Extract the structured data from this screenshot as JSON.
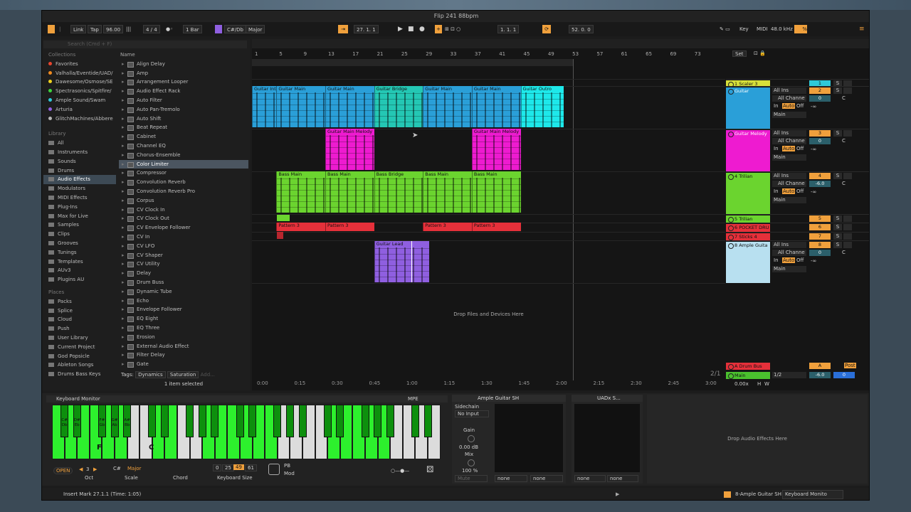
{
  "title": "Flip 241 88bpm",
  "colors": {
    "accent": "#f0a03c",
    "selection": "#4b5560",
    "lime": "#2df02d"
  },
  "transport": {
    "link": "Link",
    "tap": "Tap",
    "tempo": "96.00",
    "sig": "4 / 4",
    "quant": "1 Bar",
    "key": "C#/Db",
    "scale": "Major",
    "pos": "27. 1. 1",
    "loop_start": "1. 1. 1",
    "loop_len": "52. 0. 0",
    "key_btn": "Key",
    "midi_btn": "MIDI",
    "sample_rate": "48.0 kHz",
    "cpu": "%"
  },
  "browser": {
    "search_placeholder": "Search (Cmd + F)",
    "name_header": "Name",
    "collections_header": "Collections",
    "collections": [
      {
        "label": "Favorites",
        "color": "#e8452e"
      },
      {
        "label": "Valhalla/Eventide/UAD/",
        "color": "#f08a1f"
      },
      {
        "label": "Dawesome/Osmose/SE",
        "color": "#f0d21f"
      },
      {
        "label": "Spectrasonics/Spitfire/",
        "color": "#3dd43d"
      },
      {
        "label": "Ample Sound/Swam",
        "color": "#2fc9d8"
      },
      {
        "label": "Arturia",
        "color": "#8f5fe0"
      },
      {
        "label": "GlitchMachines/Abbere",
        "color": "#b5b5b5"
      }
    ],
    "library_header": "Library",
    "library": [
      "All",
      "Instruments",
      "Sounds",
      "Drums",
      "Audio Effects",
      "Modulators",
      "MIDI Effects",
      "Plug-Ins",
      "Max for Live",
      "Samples",
      "Clips",
      "Grooves",
      "Tunings",
      "Templates",
      "AUv3",
      "Plugins AU"
    ],
    "places_header": "Places",
    "places": [
      "Packs",
      "Splice",
      "Cloud",
      "Push",
      "User Library",
      "Current Project",
      "God Popsicle",
      "Ableton Songs",
      "Drums Bass Keys"
    ],
    "items": [
      "Align Delay",
      "Amp",
      "Arrangement Looper",
      "Audio Effect Rack",
      "Auto Filter",
      "Auto Pan-Tremolo",
      "Auto Shift",
      "Beat Repeat",
      "Cabinet",
      "Channel EQ",
      "Chorus-Ensemble",
      "Color Limiter",
      "Compressor",
      "Convolution Reverb",
      "Convolution Reverb Pro",
      "Corpus",
      "CV Clock In",
      "CV Clock Out",
      "CV Envelope Follower",
      "CV In",
      "CV LFO",
      "CV Shaper",
      "CV Utility",
      "Delay",
      "Drum Buss",
      "Dynamic Tube",
      "Echo",
      "Envelope Follower",
      "EQ Eight",
      "EQ Three",
      "Erosion",
      "External Audio Effect",
      "Filter Delay",
      "Gate"
    ],
    "tags_label": "Tags:",
    "tags": [
      "Dynamics",
      "Saturation",
      "Add..."
    ],
    "status": "1 item selected"
  },
  "ruler": [
    "1",
    "5",
    "9",
    "13",
    "17",
    "21",
    "25",
    "29",
    "33",
    "37",
    "41",
    "45",
    "49",
    "53",
    "57",
    "61",
    "65",
    "69",
    "73"
  ],
  "timeline": [
    "0:00",
    "0:15",
    "0:30",
    "0:45",
    "1:00",
    "1:15",
    "1:30",
    "1:45",
    "2:00",
    "2:15",
    "2:30",
    "2:45",
    "3:00"
  ],
  "clips": {
    "gi": "Guitar Intro",
    "gm": "Guitar Main",
    "gb": "Guitar Bridge",
    "go": "Guitar Outro",
    "gmm": "Guitar Main Melody",
    "bm": "Bass Main",
    "bb": "Bass Bridge",
    "p3": "Pattern 3",
    "gl": "Guitar Lead"
  },
  "drop_files": "Drop Files and Devices Here",
  "tracks": [
    {
      "name": "1 Scaler 3",
      "num": "1"
    },
    {
      "name": "Guitar",
      "num": "2",
      "in": "All Ins",
      "ch": "All Channe",
      "mon": "In",
      "auto": "Auto",
      "off": "Off",
      "vol": "0",
      "pan": "C",
      "out": "Main",
      "db": "-∞"
    },
    {
      "name": "Guitar Melody",
      "num": "3",
      "in": "All Ins",
      "ch": "All Channe",
      "mon": "In",
      "auto": "Auto",
      "off": "Off",
      "vol": "0",
      "pan": "C",
      "out": "Main",
      "db": "-∞"
    },
    {
      "name": "4 Trilian",
      "num": "4",
      "in": "All Ins",
      "ch": "All Channe",
      "mon": "In",
      "auto": "Auto",
      "off": "Off",
      "vol": "-6.0",
      "pan": "C",
      "out": "Main",
      "db": "-∞"
    },
    {
      "name": "5 Trilian",
      "num": "5"
    },
    {
      "name": "6 POCKET DRU",
      "num": "6"
    },
    {
      "name": "7 Sticks 4",
      "num": "7"
    },
    {
      "name": "8 Ample Guita",
      "num": "8",
      "in": "All Ins",
      "ch": "All Channe",
      "mon": "In",
      "auto": "Auto",
      "off": "Off",
      "vol": "0",
      "pan": "C",
      "out": "Main",
      "db": "-∞"
    }
  ],
  "returns": {
    "drum_bus": "A Drum Bus",
    "ret": "A",
    "post": "Post",
    "main": "Main",
    "main_out": "1/2",
    "main_vol": "-6.0",
    "main_pan": "0",
    "sets": "Set",
    "page": "2/1",
    "zoom": "0.00x",
    "h": "H",
    "w": "W",
    "s": "S"
  },
  "devices": {
    "kbd_title": "Keyboard Monitor",
    "mpe": "MPE",
    "open": "OPEN",
    "oct_val": "3",
    "oct": "Oct",
    "root": "C#",
    "mode": "Major",
    "scale": "Scale",
    "chord": "Chord",
    "ksize": [
      "0",
      "25",
      "49",
      "61"
    ],
    "ksize_label": "Keyboard Size",
    "pb": "PB",
    "mod": "Mod",
    "key_labels": {
      "c": "C#\nDb",
      "d": "D#\nEb",
      "f": "F#\nGb",
      "g": "G#\nAb",
      "a": "A#\nBb"
    },
    "f": "F",
    "c": "C",
    "amp_title": "Ample Guitar SH",
    "sidechain": "Sidechain",
    "no_input": "No Input",
    "gain": "Gain",
    "gain_val": "0.00 dB",
    "mix": "Mix",
    "mix_val": "100 %",
    "mute": "Mute",
    "none": "none",
    "uad_title": "UADx S...",
    "drop_fx": "Drop Audio Effects Here"
  },
  "statusbar": {
    "msg": "Insert Mark 27.1.1 (Time: 1:05)",
    "track": "8-Ample Guitar SH",
    "dev": "Keyboard Monito"
  }
}
